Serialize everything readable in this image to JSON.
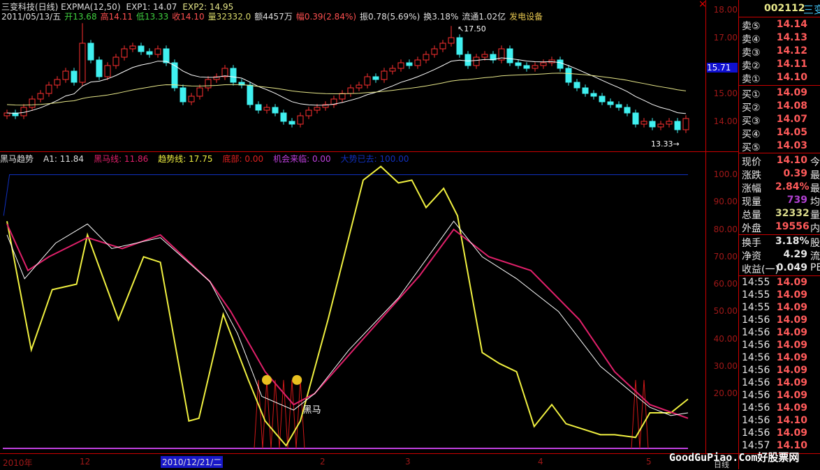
{
  "header": {
    "line1": [
      {
        "t": "三变科技(日线) EXPMA(12,50)",
        "c": "#e0e0e0"
      },
      {
        "t": "EXP1: 14.07",
        "c": "#e0e0e0"
      },
      {
        "t": "EXP2: 14.95",
        "c": "#e8e88a"
      }
    ],
    "line2": [
      {
        "t": "2011/05/13/五",
        "c": "#e0e0e0"
      },
      {
        "t": "开13.68",
        "c": "#3fd03f"
      },
      {
        "t": "高14.11",
        "c": "#ff5050"
      },
      {
        "t": "低13.33",
        "c": "#3fd03f"
      },
      {
        "t": "收14.10",
        "c": "#ff5050"
      },
      {
        "t": "量32332.0",
        "c": "#d8d86a"
      },
      {
        "t": "额4457万",
        "c": "#e0e0e0"
      },
      {
        "t": "幅0.39(2.84%)",
        "c": "#ff5050"
      },
      {
        "t": "振0.78(5.69%)",
        "c": "#e0e0e0"
      },
      {
        "t": "换3.18%",
        "c": "#e0e0e0"
      },
      {
        "t": "流通1.02亿",
        "c": "#e0e0e0"
      },
      {
        "t": "发电设备",
        "c": "#e8c850"
      }
    ]
  },
  "indicator_header": [
    {
      "t": "黑马趋势",
      "c": "#e0e0e0"
    },
    {
      "t": "A1: 11.84",
      "c": "#e0e0e0"
    },
    {
      "t": "黑马线: 11.86",
      "c": "#e0206a"
    },
    {
      "t": "趋势线: 17.75",
      "c": "#f0f040"
    },
    {
      "t": "底部: 0.00",
      "c": "#e02020"
    },
    {
      "t": "机会来临: 0.00",
      "c": "#c040e0"
    },
    {
      "t": "大势已去: 100.00",
      "c": "#1030c0"
    }
  ],
  "price_ticks": [
    "18.00",
    "17.00",
    "15.00",
    "14.00"
  ],
  "price_cursor": "15.71",
  "indicator_ticks": [
    "100.0",
    "90.00",
    "80.00",
    "70.00",
    "60.00",
    "50.00",
    "40.00",
    "30.00",
    "20.00"
  ],
  "annotations": {
    "high": "17.50",
    "low": "13.33",
    "signal": "黑马"
  },
  "date_axis": {
    "labels": [
      "2010年",
      "12",
      "2",
      "3",
      "4",
      "5"
    ],
    "cursor_date": "2010/12/21/二",
    "period": "日线"
  },
  "watermark": "GoodGuPiao.Com好股票网",
  "quote": {
    "code": "002112",
    "name": "三变",
    "sells": [
      {
        "l": "卖⑤",
        "v": "14.14"
      },
      {
        "l": "卖④",
        "v": "14.13"
      },
      {
        "l": "卖③",
        "v": "14.12"
      },
      {
        "l": "卖②",
        "v": "14.11"
      },
      {
        "l": "卖①",
        "v": "14.10"
      }
    ],
    "buys": [
      {
        "l": "买①",
        "v": "14.09"
      },
      {
        "l": "买②",
        "v": "14.08"
      },
      {
        "l": "买③",
        "v": "14.07"
      },
      {
        "l": "买④",
        "v": "14.05"
      },
      {
        "l": "买⑤",
        "v": "14.03"
      }
    ],
    "stats": [
      {
        "l": "现价",
        "v": "14.10",
        "e": "今",
        "c": "#ff5a5a"
      },
      {
        "l": "涨跌",
        "v": "0.39",
        "e": "最",
        "c": "#ff5a5a"
      },
      {
        "l": "涨幅",
        "v": "2.84%",
        "e": "最",
        "c": "#ff5a5a"
      },
      {
        "l": "现量",
        "v": "739",
        "e": "均",
        "c": "#b040d0"
      },
      {
        "l": "总量",
        "v": "32332",
        "e": "量",
        "c": "#d8d88a"
      },
      {
        "l": "外盘",
        "v": "19556",
        "e": "内",
        "c": "#ff5a5a"
      }
    ],
    "stats2": [
      {
        "l": "换手",
        "v": "3.18%",
        "e": "股"
      },
      {
        "l": "净资",
        "v": "4.29",
        "e": "流"
      },
      {
        "l": "收益(一)",
        "v": "0.049",
        "e": "PE"
      }
    ],
    "ticks": [
      {
        "t": "14:55",
        "p": "14.09"
      },
      {
        "t": "14:55",
        "p": "14.09"
      },
      {
        "t": "14:55",
        "p": "14.09"
      },
      {
        "t": "14:56",
        "p": "14.09"
      },
      {
        "t": "14:56",
        "p": "14.09"
      },
      {
        "t": "14:56",
        "p": "14.09"
      },
      {
        "t": "14:56",
        "p": "14.09"
      },
      {
        "t": "14:56",
        "p": "14.09"
      },
      {
        "t": "14:56",
        "p": "14.09"
      },
      {
        "t": "14:56",
        "p": "14.09"
      },
      {
        "t": "14:56",
        "p": "14.09"
      },
      {
        "t": "14:56",
        "p": "14.10"
      },
      {
        "t": "14:56",
        "p": "14.09"
      },
      {
        "t": "14:57",
        "p": "14.10"
      }
    ]
  },
  "chart_data": [
    {
      "type": "candlestick",
      "title": "三变科技(日线)",
      "ylim": [
        13.3,
        18.2
      ],
      "closes": [
        14.3,
        14.2,
        14.5,
        14.8,
        15.0,
        15.3,
        15.5,
        15.8,
        15.4,
        16.8,
        16.2,
        15.6,
        16.0,
        16.3,
        16.6,
        16.7,
        16.5,
        16.4,
        16.6,
        16.1,
        15.2,
        14.7,
        14.9,
        15.2,
        15.5,
        15.6,
        15.9,
        15.4,
        15.3,
        14.6,
        14.4,
        14.5,
        14.3,
        14.0,
        13.9,
        14.2,
        14.4,
        14.5,
        14.6,
        14.8,
        15.0,
        15.2,
        15.3,
        15.6,
        15.5,
        15.8,
        15.9,
        16.1,
        16.0,
        16.2,
        16.4,
        16.6,
        16.8,
        17.0,
        16.4,
        16.0,
        16.3,
        16.4,
        16.2,
        16.6,
        16.1,
        16.0,
        15.9,
        16.0,
        16.1,
        16.2,
        15.9,
        15.4,
        15.2,
        15.0,
        14.9,
        14.7,
        14.6,
        14.5,
        14.3,
        13.9,
        14.0,
        13.8,
        13.9,
        14.0,
        13.7,
        14.1
      ],
      "series": [
        {
          "name": "EXP1",
          "period": 12,
          "color": "#ffffff"
        },
        {
          "name": "EXP2",
          "period": 50,
          "color": "#e8e88a"
        }
      ]
    },
    {
      "type": "line",
      "title": "黑马趋势",
      "ylim": [
        0,
        105
      ],
      "series": [
        {
          "name": "趋势线",
          "color": "#f0f040",
          "points": [
            [
              0,
              83
            ],
            [
              2.9,
              36
            ],
            [
              5.4,
              58
            ],
            [
              8.3,
              60
            ],
            [
              9.6,
              78
            ],
            [
              13.3,
              47
            ],
            [
              16.3,
              70
            ],
            [
              18.3,
              68
            ],
            [
              21.7,
              10
            ],
            [
              22.9,
              11
            ],
            [
              25.8,
              49
            ],
            [
              28.8,
              25
            ],
            [
              30.8,
              10
            ],
            [
              33.3,
              1
            ],
            [
              35,
              10
            ],
            [
              38.3,
              47
            ],
            [
              42.5,
              98
            ],
            [
              44.6,
              103
            ],
            [
              46.7,
              97
            ],
            [
              48.3,
              98
            ],
            [
              50,
              88
            ],
            [
              52.1,
              95
            ],
            [
              53.75,
              85
            ],
            [
              56.7,
              35
            ],
            [
              58.75,
              31
            ],
            [
              60.8,
              28
            ],
            [
              62.9,
              8
            ],
            [
              65,
              16
            ],
            [
              66.7,
              9
            ],
            [
              70.8,
              5
            ],
            [
              72.5,
              5
            ],
            [
              75,
              4
            ],
            [
              76.7,
              13
            ],
            [
              79.2,
              13
            ],
            [
              81.25,
              18
            ]
          ]
        },
        {
          "name": "黑马线",
          "color": "#e0206a",
          "points": [
            [
              0,
              82
            ],
            [
              2.5,
              65
            ],
            [
              5,
              70
            ],
            [
              9.6,
              77
            ],
            [
              13.75,
              73
            ],
            [
              18.3,
              78
            ],
            [
              24.2,
              61
            ],
            [
              26.7,
              50
            ],
            [
              30.8,
              28
            ],
            [
              34.2,
              16
            ],
            [
              36.7,
              20
            ],
            [
              42.5,
              40
            ],
            [
              49.2,
              63
            ],
            [
              53.3,
              80
            ],
            [
              57.5,
              70
            ],
            [
              62.5,
              65
            ],
            [
              68.3,
              47
            ],
            [
              72.5,
              28
            ],
            [
              76.7,
              16
            ],
            [
              81.25,
              11
            ]
          ]
        },
        {
          "name": "A1",
          "color": "#ffffff",
          "points": [
            [
              0,
              78
            ],
            [
              2.1,
              62
            ],
            [
              5.8,
              75
            ],
            [
              9.6,
              82
            ],
            [
              12.5,
              73
            ],
            [
              18.3,
              77
            ],
            [
              24.2,
              61
            ],
            [
              27.5,
              42
            ],
            [
              30.4,
              19
            ],
            [
              34.2,
              14
            ],
            [
              36.7,
              20
            ],
            [
              40.8,
              36
            ],
            [
              46.7,
              55
            ],
            [
              53.3,
              83
            ],
            [
              56.7,
              70
            ],
            [
              60.8,
              62
            ],
            [
              65.8,
              50
            ],
            [
              70.8,
              30
            ],
            [
              76.7,
              15
            ],
            [
              79.2,
              12
            ],
            [
              81.25,
              13
            ]
          ]
        }
      ],
      "levels": {
        "大势已去": 100,
        "机会来临": 0
      },
      "bottom_signals": [
        30,
        31,
        32,
        33,
        34,
        35,
        75,
        76
      ],
      "smiley_at": [
        31,
        34.6
      ]
    }
  ]
}
